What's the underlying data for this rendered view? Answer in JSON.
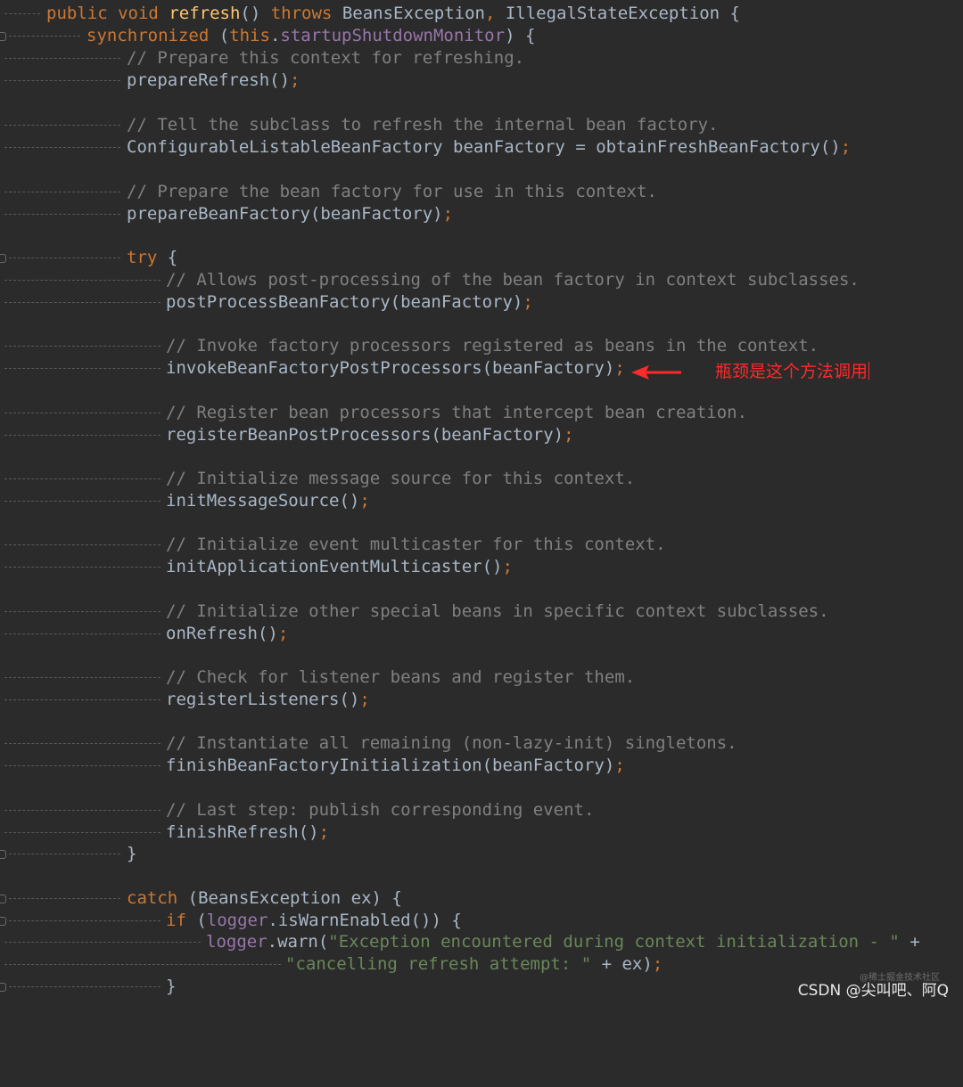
{
  "code": {
    "l0": [
      "public",
      "void",
      "refresh",
      "() ",
      "throws",
      "BeansException",
      ", ",
      "IllegalStateException",
      " {"
    ],
    "l1": [
      "synchronized",
      " (",
      "this",
      ".",
      "startupShutdownMonitor",
      ") {"
    ],
    "l2": "// Prepare this context for refreshing.",
    "l3": [
      "prepareRefresh()",
      ";"
    ],
    "l5": "// Tell the subclass to refresh the internal bean factory.",
    "l6": [
      "ConfigurableListableBeanFactory beanFactory = obtainFreshBeanFactory()",
      ";"
    ],
    "l8": "// Prepare the bean factory for use in this context.",
    "l9": [
      "prepareBeanFactory(beanFactory)",
      ";"
    ],
    "l11": [
      "try",
      " {"
    ],
    "l12": "// Allows post-processing of the bean factory in context subclasses.",
    "l13": [
      "postProcessBeanFactory(beanFactory)",
      ";"
    ],
    "l15": "// Invoke factory processors registered as beans in the context.",
    "l16": [
      "invokeBeanFactoryPostProcessors(beanFactory)",
      ";"
    ],
    "l18": "// Register bean processors that intercept bean creation.",
    "l19": [
      "registerBeanPostProcessors(beanFactory)",
      ";"
    ],
    "l21": "// Initialize message source for this context.",
    "l22": [
      "initMessageSource()",
      ";"
    ],
    "l24": "// Initialize event multicaster for this context.",
    "l25": [
      "initApplicationEventMulticaster()",
      ";"
    ],
    "l27": "// Initialize other special beans in specific context subclasses.",
    "l28": [
      "onRefresh()",
      ";"
    ],
    "l30": "// Check for listener beans and register them.",
    "l31": [
      "registerListeners()",
      ";"
    ],
    "l33": "// Instantiate all remaining (non-lazy-init) singletons.",
    "l34": [
      "finishBeanFactoryInitialization(beanFactory)",
      ";"
    ],
    "l36": "// Last step: publish corresponding event.",
    "l37": [
      "finishRefresh()",
      ";"
    ],
    "l38": "}",
    "l40": [
      "catch",
      " (BeansException ex) {"
    ],
    "l41": [
      "if",
      " (",
      "logger",
      ".isWarnEnabled()) {"
    ],
    "l42": [
      "logger",
      ".warn(",
      "\"Exception encountered during context initialization - \"",
      " +"
    ],
    "l43": [
      "\"cancelling refresh attempt: \"",
      " + ex)",
      ";"
    ],
    "l44": "}"
  },
  "annotation": {
    "text": "瓶颈是这个方法调用",
    "color": "#ff2a2a"
  },
  "watermark": {
    "small": "@稀土掘金技术社区",
    "main": "CSDN @尖叫吧、阿Q"
  },
  "colors": {
    "background": "#2b2b2b",
    "text": "#a9b7c6",
    "keyword": "#cc7832",
    "method_decl": "#ffc66d",
    "field": "#9876aa",
    "string": "#6a8759",
    "comment": "#808080"
  }
}
